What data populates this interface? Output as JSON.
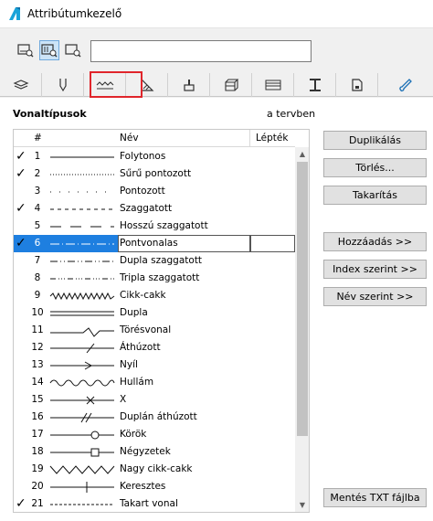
{
  "window": {
    "title": "Attribútumkezelő"
  },
  "search": {
    "value": ""
  },
  "view_buttons": [
    {
      "name": "list-view-icon",
      "active": false
    },
    {
      "name": "detail-view-icon",
      "active": true
    },
    {
      "name": "preview-view-icon",
      "active": false
    }
  ],
  "tabs": [
    {
      "name": "tab-layers"
    },
    {
      "name": "tab-pens"
    },
    {
      "name": "tab-line-types"
    },
    {
      "name": "tab-fill-types"
    },
    {
      "name": "tab-surfaces"
    },
    {
      "name": "tab-composites"
    },
    {
      "name": "tab-profiles"
    },
    {
      "name": "tab-zone-categories"
    },
    {
      "name": "tab-building-materials"
    },
    {
      "name": "tab-markup-styles"
    }
  ],
  "section": {
    "title": "Vonaltípusok",
    "subtitle": "a tervben"
  },
  "table": {
    "headers": {
      "num": "#",
      "name": "Név",
      "scale": "Lépték"
    },
    "rows": [
      {
        "num": "1",
        "name": "Folytonos",
        "checked": true,
        "pattern": "solid"
      },
      {
        "num": "2",
        "name": "Sűrű pontozott",
        "checked": true,
        "pattern": "dense-dots"
      },
      {
        "num": "3",
        "name": "Pontozott",
        "checked": false,
        "pattern": "dots"
      },
      {
        "num": "4",
        "name": "Szaggatott",
        "checked": true,
        "pattern": "dashed"
      },
      {
        "num": "5",
        "name": "Hosszú szaggatott",
        "checked": false,
        "pattern": "long-dash"
      },
      {
        "num": "6",
        "name": "Pontvonalas",
        "checked": true,
        "pattern": "dash-dot",
        "selected": true
      },
      {
        "num": "7",
        "name": "Dupla szaggatott",
        "checked": false,
        "pattern": "dash-dot-dot"
      },
      {
        "num": "8",
        "name": "Tripla szaggatott",
        "checked": false,
        "pattern": "dash-dot-dot-dot"
      },
      {
        "num": "9",
        "name": "Cikk-cakk",
        "checked": false,
        "pattern": "zigzag"
      },
      {
        "num": "10",
        "name": "Dupla",
        "checked": false,
        "pattern": "double"
      },
      {
        "num": "11",
        "name": "Törésvonal",
        "checked": false,
        "pattern": "break"
      },
      {
        "num": "12",
        "name": "Áthúzott",
        "checked": false,
        "pattern": "cross-slash"
      },
      {
        "num": "13",
        "name": "Nyíl",
        "checked": false,
        "pattern": "arrow"
      },
      {
        "num": "14",
        "name": "Hullám",
        "checked": false,
        "pattern": "wave"
      },
      {
        "num": "15",
        "name": "X",
        "checked": false,
        "pattern": "x"
      },
      {
        "num": "16",
        "name": "Duplán áthúzott",
        "checked": false,
        "pattern": "double-slash"
      },
      {
        "num": "17",
        "name": "Körök",
        "checked": false,
        "pattern": "circle"
      },
      {
        "num": "18",
        "name": "Négyzetek",
        "checked": false,
        "pattern": "square"
      },
      {
        "num": "19",
        "name": "Nagy cikk-cakk",
        "checked": false,
        "pattern": "big-zigzag"
      },
      {
        "num": "20",
        "name": "Keresztes",
        "checked": false,
        "pattern": "cross"
      },
      {
        "num": "21",
        "name": "Takart vonal",
        "checked": true,
        "pattern": "hidden"
      }
    ]
  },
  "buttons": {
    "duplicate": "Duplikálás",
    "delete": "Törlés...",
    "purge": "Takarítás",
    "add": "Hozzáadás >>",
    "by_index": "Index szerint >>",
    "by_name": "Név szerint >>",
    "save_txt": "Mentés TXT fájlba"
  },
  "colors": {
    "accent": "#1e7fe0",
    "highlight_box": "#e0252b"
  }
}
